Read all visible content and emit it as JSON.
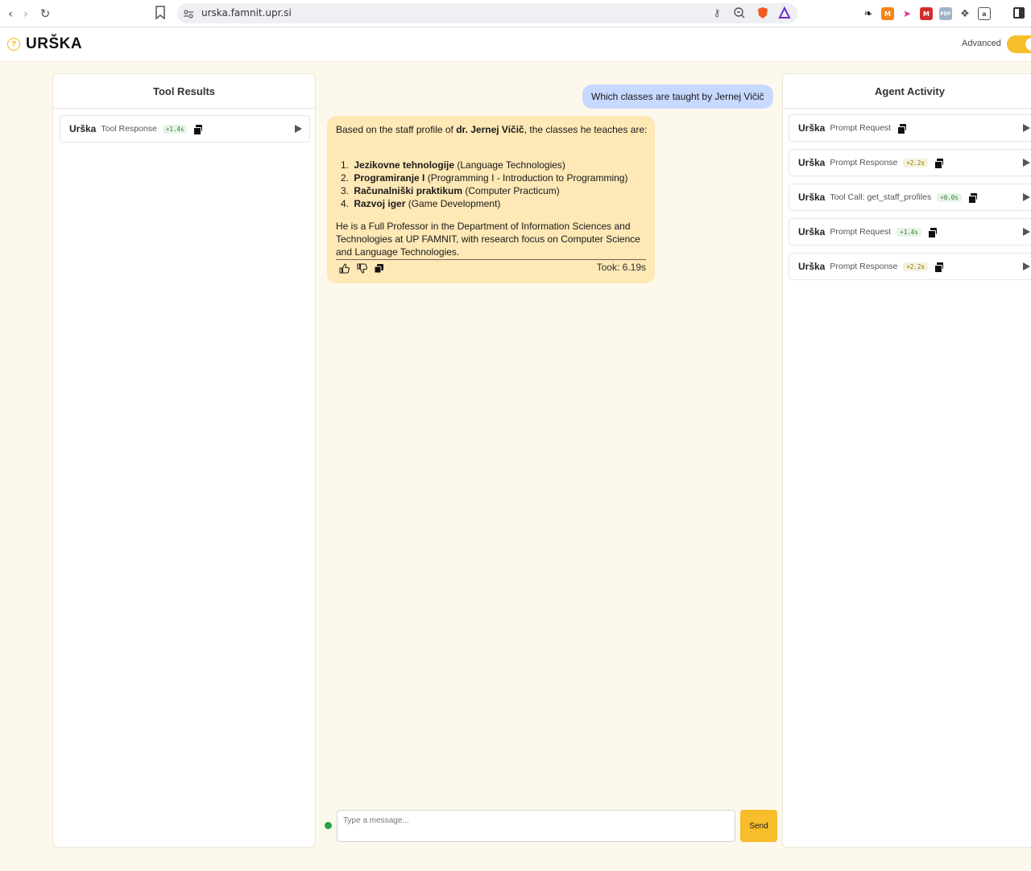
{
  "browser": {
    "url": "urska.famnit.upr.si"
  },
  "app": {
    "title": "URŠKA",
    "advanced_label": "Advanced",
    "advanced_enabled": true,
    "accent_color": "#f7bd2a"
  },
  "tool_results": {
    "title": "Tool Results",
    "items": [
      {
        "name": "Urška",
        "type": "Tool Response",
        "badge": "+1.4s"
      }
    ]
  },
  "agent_activity": {
    "title": "Agent Activity",
    "items": [
      {
        "name": "Urška",
        "type": "Prompt Request",
        "badge": ""
      },
      {
        "name": "Urška",
        "type": "Prompt Response",
        "badge": "+2.2s"
      },
      {
        "name": "Urška",
        "type": "Tool Call: get_staff_profiles",
        "badge": "+0.0s"
      },
      {
        "name": "Urška",
        "type": "Prompt Request",
        "badge": "+1.4s"
      },
      {
        "name": "Urška",
        "type": "Prompt Response",
        "badge": "+2.2s"
      }
    ]
  },
  "chat": {
    "user_message": "Which classes are taught by Jernej Vičič",
    "bot": {
      "intro_prefix": "Based on the staff profile of ",
      "intro_bold": "dr. Jernej Vičič",
      "intro_suffix": ", the classes he teaches are:",
      "classes": [
        {
          "num": "1.",
          "name": "Jezikovne tehnologije",
          "desc": " (Language Technologies)"
        },
        {
          "num": "2.",
          "name": "Programiranje I",
          "desc": " (Programming I - Introduction to Programming)"
        },
        {
          "num": "3.",
          "name": "Računalniški praktikum",
          "desc": " (Computer Practicum)"
        },
        {
          "num": "4.",
          "name": "Razvoj iger",
          "desc": " (Game Development)"
        }
      ],
      "outro": "He is a Full Professor in the Department of Information Sciences and Technologies at UP FAMNIT, with research focus on Computer Science and Language Technologies.",
      "took": "Took: 6.19s"
    }
  },
  "composer": {
    "placeholder": "Type a message...",
    "send_label": "Send",
    "status_color": "#22a447"
  }
}
